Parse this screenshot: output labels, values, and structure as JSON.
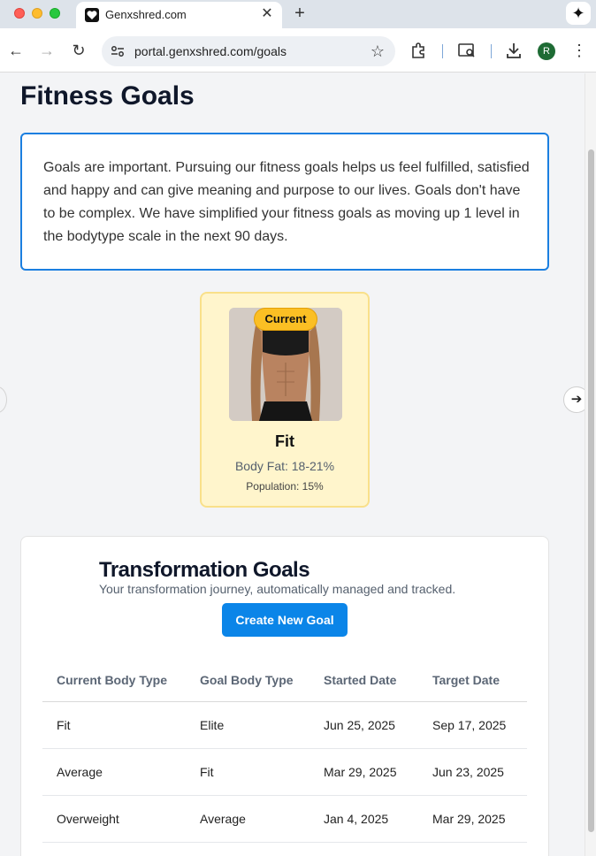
{
  "browser": {
    "tab_title": "Genxshred.com",
    "url": "portal.genxshred.com/goals",
    "profile_initial": "R"
  },
  "page": {
    "title": "Fitness Goals",
    "intro": "Goals are important. Pursuing our fitness goals helps us feel fulfilled, satisfied and happy and can give meaning and purpose to our lives. Goals don't have to be complex. We have simplified your fitness goals as moving up 1 level in the bodytype scale in the next 90 days."
  },
  "body_card": {
    "badge": "Current",
    "name": "Fit",
    "body_fat": "Body Fat: 18-21%",
    "population": "Population: 15%"
  },
  "transformation": {
    "title": "Transformation Goals",
    "subtitle": "Your transformation journey, automatically managed and tracked.",
    "create_button": "Create New Goal",
    "columns": [
      "Current Body Type",
      "Goal Body Type",
      "Started Date",
      "Target Date"
    ],
    "rows": [
      [
        "Fit",
        "Elite",
        "Jun 25, 2025",
        "Sep 17, 2025"
      ],
      [
        "Average",
        "Fit",
        "Mar 29, 2025",
        "Jun 23, 2025"
      ],
      [
        "Overweight",
        "Average",
        "Jan 4, 2025",
        "Mar 29, 2025"
      ]
    ]
  },
  "colors": {
    "accent": "#0b85e8",
    "intro_border": "#1b7fe0",
    "card_highlight": "#fff5cc",
    "badge": "#fbbf24"
  }
}
